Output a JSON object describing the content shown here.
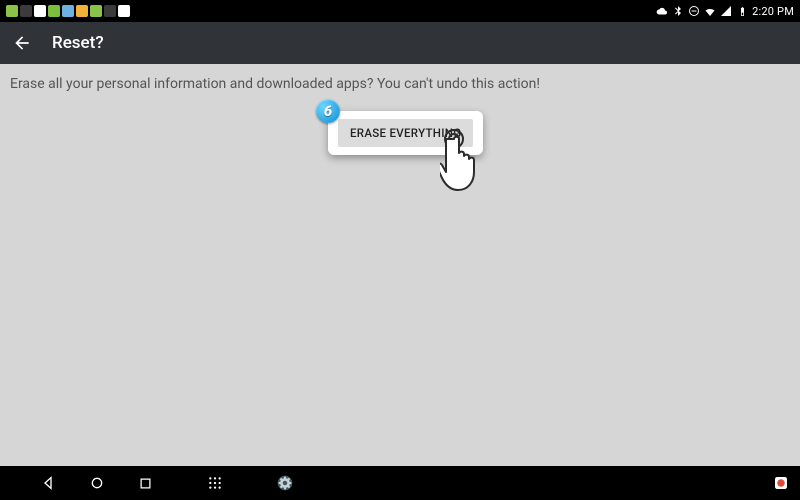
{
  "status_bar": {
    "left_apps": [
      {
        "name": "app1",
        "color": "#8bc34a"
      },
      {
        "name": "app2",
        "color": "#3b3b3b"
      },
      {
        "name": "app3",
        "color": "#ffffff"
      },
      {
        "name": "app4",
        "color": "#7bbf3c"
      },
      {
        "name": "app5",
        "color": "#6fb0e2"
      },
      {
        "name": "app6",
        "color": "#f0b238"
      },
      {
        "name": "app7",
        "color": "#8bc34a"
      },
      {
        "name": "app8",
        "color": "#3b3b3b"
      },
      {
        "name": "app9",
        "color": "#ffffff"
      }
    ],
    "time": "2:20 PM"
  },
  "action_bar": {
    "title": "Reset?"
  },
  "content": {
    "warning_text": "Erase all your personal information and downloaded apps? You can't undo this action!",
    "erase_button_label": "ERASE EVERYTHING",
    "step_number": "6"
  }
}
